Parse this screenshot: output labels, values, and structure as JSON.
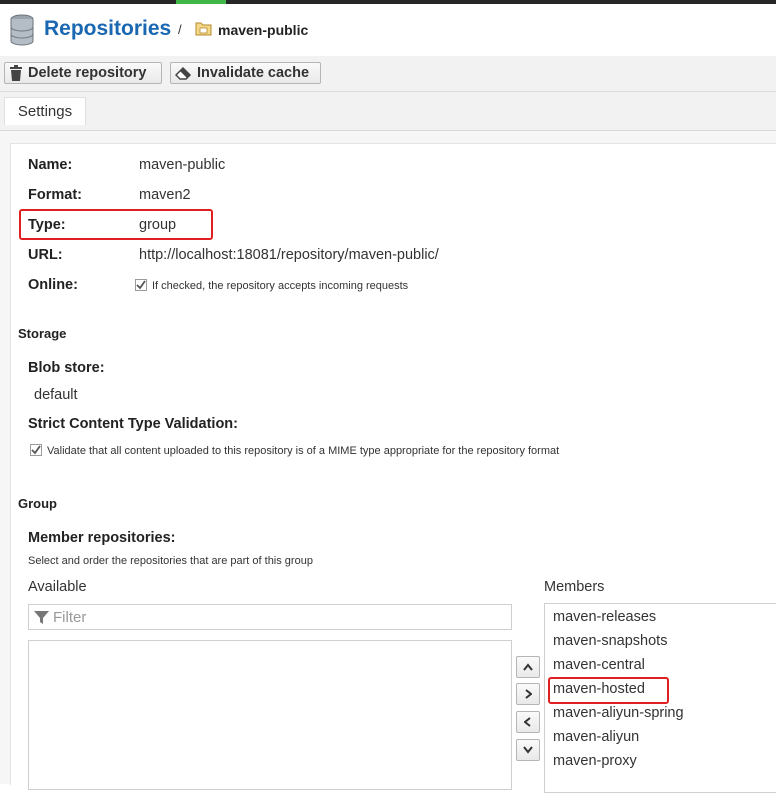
{
  "header": {
    "title": "Repositories",
    "separator": "/",
    "breadcrumb": "maven-public"
  },
  "toolbar": {
    "delete_label": "Delete repository",
    "invalidate_label": "Invalidate cache"
  },
  "tabs": [
    {
      "label": "Settings",
      "active": true
    }
  ],
  "settings": {
    "name_label": "Name:",
    "name_value": "maven-public",
    "format_label": "Format:",
    "format_value": "maven2",
    "type_label": "Type:",
    "type_value": "group",
    "url_label": "URL:",
    "url_value": "http://localhost:18081/repository/maven-public/",
    "online_label": "Online:",
    "online_checked": true,
    "online_desc": "If checked, the repository accepts incoming requests"
  },
  "storage": {
    "section": "Storage",
    "blob_label": "Blob store:",
    "blob_value": "default",
    "strict_label": "Strict Content Type Validation:",
    "strict_checked": true,
    "strict_desc": "Validate that all content uploaded to this repository is of a MIME type appropriate for the repository format"
  },
  "group": {
    "section": "Group",
    "member_label": "Member repositories:",
    "member_desc": "Select and order the repositories that are part of this group",
    "available_label": "Available",
    "filter_placeholder": "Filter",
    "members_label": "Members",
    "members": [
      "maven-releases",
      "maven-snapshots",
      "maven-central",
      "maven-hosted",
      "maven-aliyun-spring",
      "maven-aliyun",
      "maven-proxy"
    ]
  },
  "colors": {
    "accent": "#1a68b1",
    "highlight": "#e02020",
    "topbar_accent": "#41b649"
  }
}
